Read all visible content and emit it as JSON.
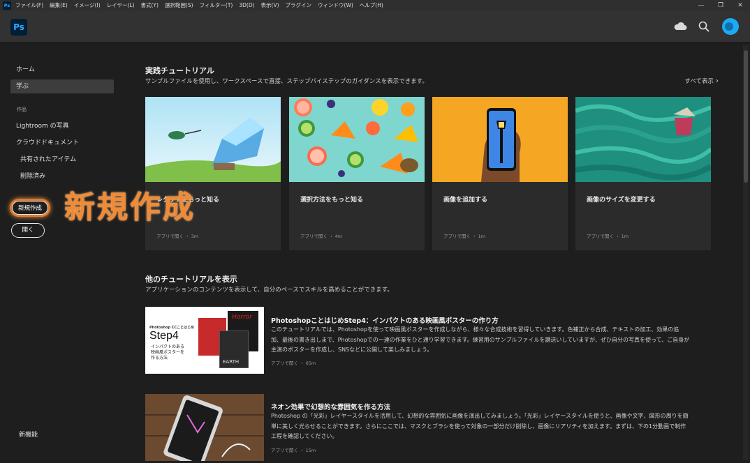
{
  "menubar": {
    "app_icon": "Ps",
    "menus": [
      "ファイル(F)",
      "編集(E)",
      "イメージ(I)",
      "レイヤー(L)",
      "書式(Y)",
      "選択範囲(S)",
      "フィルター(T)",
      "3D(D)",
      "表示(V)",
      "プラグイン",
      "ウィンドウ(W)",
      "ヘルプ(H)"
    ],
    "controls": [
      "—",
      "❐",
      "✕"
    ]
  },
  "topbar": {
    "logo": "Ps",
    "icons": [
      "cloud-icon",
      "search-icon",
      "avatar"
    ]
  },
  "sidebar": {
    "home": "ホーム",
    "learn": "学ぶ",
    "section_works": "作品",
    "lightroom": "Lightroom の写真",
    "cloud_docs": "クラウドドキュメント",
    "shared": "共有されたアイテム",
    "deleted": "削除済み",
    "new_button": "新規作成",
    "open_button": "開く",
    "whats_new": "新機能"
  },
  "annotation": "新規作成",
  "hands_on": {
    "title": "実践チュートリアル",
    "subtitle": "サンプルファイルを使用し、ワークスペースで直接、ステップバイステップのガイダンスを表示できます。",
    "see_all": "すべて表示",
    "cards": [
      {
        "title": "レタッチをもっと知る",
        "meta": "アプリで開く ・ 3m"
      },
      {
        "title": "選択方法をもっと知る",
        "meta": "アプリで開く ・ 4m"
      },
      {
        "title": "画像を追加する",
        "meta": "アプリで開く ・ 1m"
      },
      {
        "title": "画像のサイズを変更する",
        "meta": "アプリで開く ・ 1m"
      }
    ]
  },
  "more": {
    "title": "他のチュートリアルを表示",
    "subtitle": "アプリケーションのコンテンツを表示して、自分のペースでスキルを高めることができます。",
    "items": [
      {
        "title": "PhotoshopことはじめStep4：インパクトのある映画風ポスターの作り方",
        "desc": "このチュートリアルでは、Photoshopを使って映画風ポスターを作成しながら、様々な合成技術を習得していきます。色補正から合成、テキストの加工、効果の追加、最後の書き出しまで、Photoshopでの一連の作業をひと通り学習できます。練習用のサンプルファイルを譲送いしていますが、ぜひ自分の写真を使って、ご自身が主演のポスターを作成し、SNSなどに公開して楽しみましょう。",
        "meta": "アプリで開く ・ 65m",
        "thumb_label": "Photoshop CCことはじめ",
        "thumb_step": "Step4",
        "thumb_caption": "インパクトのある\n映画風ポスターを\n作る方法",
        "thumb_poster1": "Horror",
        "thumb_poster2": "EARTH"
      },
      {
        "title": "ネオン効果で幻想的な雰囲気を作る方法",
        "desc": "Photoshop の「光彩」レイヤースタイルを活用して、幻想的な雰囲気に画像を演出してみましょう。「光彩」レイヤースタイルを使うと、画像や文字、図形の周りを簡単に美しく光らせることができます。さらにここでは、マスクとブラシを使って対象の一部分だけ削除し、画像にリアリティを加えます。まずは、下の1分動画で制作工程を確認してください。",
        "meta": "アプリで開く ・ 15m"
      }
    ]
  },
  "colors": {
    "accent": "#31a8ff",
    "highlight": "#f08a35",
    "background": "#1e1e1e",
    "card": "#2b2b2b"
  }
}
